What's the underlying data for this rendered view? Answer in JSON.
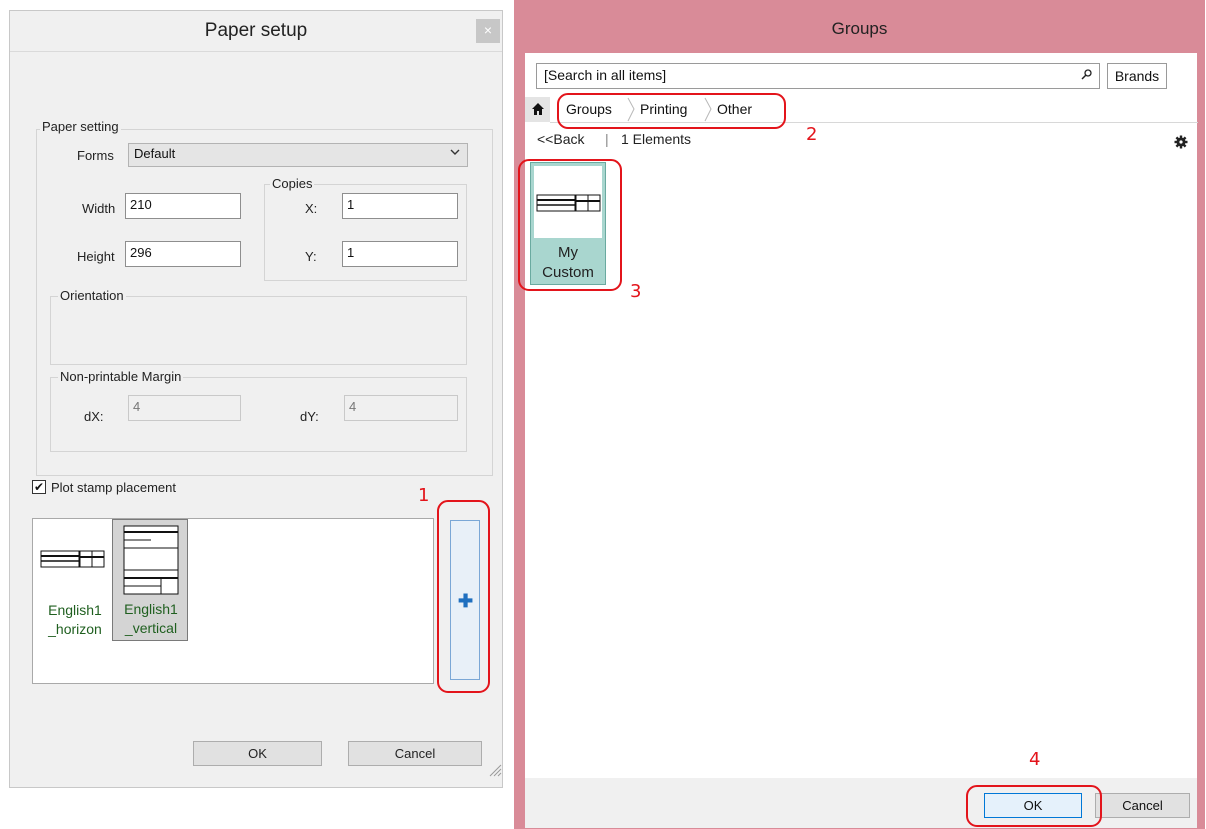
{
  "paper_setup": {
    "title": "Paper setup",
    "close_label": "×",
    "paper_setting": {
      "legend": "Paper setting",
      "forms_label": "Forms",
      "forms_value": "Default",
      "width_label": "Width",
      "width_value": "210",
      "height_label": "Height",
      "height_value": "296",
      "copies": {
        "legend": "Copies",
        "x_label": "X:",
        "x_value": "1",
        "y_label": "Y:",
        "y_value": "1"
      },
      "orientation_legend": "Orientation",
      "margin": {
        "legend": "Non-printable Margin",
        "dx_label": "dX:",
        "dx_value": "4",
        "dy_label": "dY:",
        "dy_value": "4"
      }
    },
    "plot_stamp": {
      "label": "Plot stamp placement",
      "checked": true,
      "check_mark": "✔",
      "items": [
        {
          "line1": "English1",
          "line2": "_horizon"
        },
        {
          "line1": "English1",
          "line2": "_vertical"
        }
      ],
      "add_label": "✚"
    },
    "ok_label": "OK",
    "cancel_label": "Cancel"
  },
  "groups": {
    "title": "Groups",
    "search_placeholder": "[Search in all items]",
    "brands_label": "Brands",
    "breadcrumb": [
      "Groups",
      "Printing",
      "Other"
    ],
    "back_label": "<<Back",
    "count_label": "1 Elements",
    "tile": {
      "line1": "My",
      "line2": "Custom"
    },
    "ok_label": "OK",
    "cancel_label": "Cancel"
  },
  "annotations": [
    "1",
    "2",
    "3",
    "4"
  ],
  "colors": {
    "annotation": "#e3141b",
    "groups_frame": "#d98b98",
    "tile_selected": "#a9d6cf",
    "stamp_caption": "#1f5f1f"
  }
}
